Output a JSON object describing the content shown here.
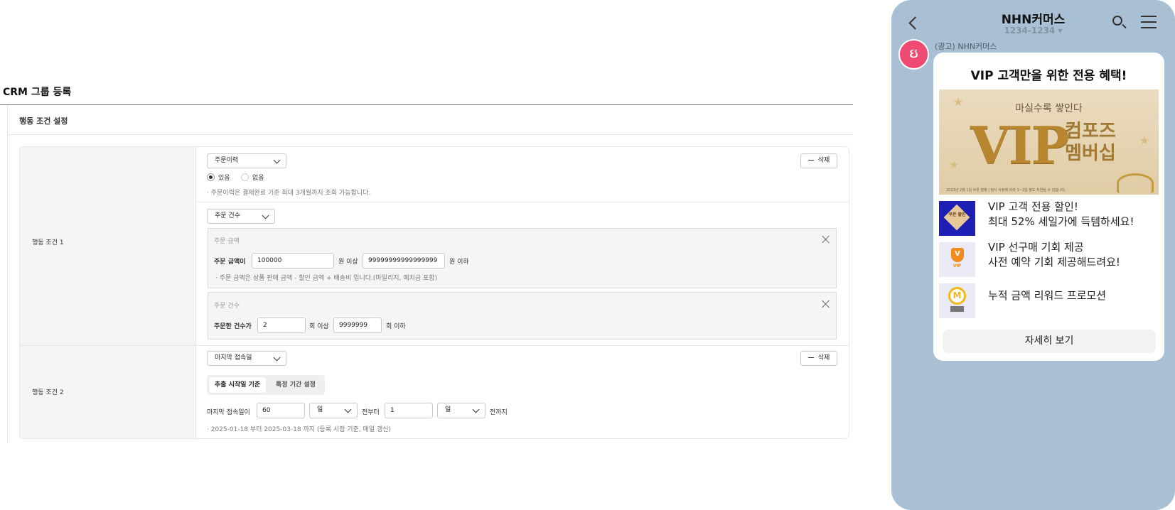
{
  "page": {
    "title": "CRM 그룹 등록",
    "section_title": "행동 조건 설정"
  },
  "condition1": {
    "label": "행동 조건 1",
    "type_select": "주문이력",
    "delete_label": "삭제",
    "radio_yes": "있음",
    "radio_no": "없음",
    "radio_selected": "있음",
    "note": "주문이력은 결제완료 기준 최대 3개월까지 조회 가능합니다.",
    "sub_select": "주문 건수",
    "amount_box": {
      "title": "주문 금액",
      "prefix": "주문 금액이",
      "min_value": "100000",
      "min_suffix": "원 이상",
      "max_value": "99999999999999999",
      "max_suffix": "원 이하",
      "note": "주문 금액은 상품 판매 금액 - 할인 금액 + 배송비 입니다.(마일리지, 예치금 포함)"
    },
    "count_box": {
      "title": "주문 건수",
      "prefix": "주문한 건수가",
      "min_value": "2",
      "min_suffix": "회 이상",
      "max_value": "9999999",
      "max_suffix": "회 이하"
    }
  },
  "condition2": {
    "label": "행동 조건 2",
    "type_select": "마지막 접속일",
    "delete_label": "삭제",
    "tab_active": "추출 시작일 기준",
    "tab_inactive": "특정 기간 설정",
    "prefix": "마지막 접속일이",
    "from_value": "60",
    "from_unit": "일",
    "from_suffix": "전부터",
    "to_value": "1",
    "to_unit": "일",
    "to_suffix": "전까지",
    "note": "2025-01-18 부터 2025-03-18 까지 (등록 시점 기준, 매일 갱신)"
  },
  "phone": {
    "title": "NHN커머스",
    "subtitle": "1234-1234 ▾",
    "sender": "(광고) NHN커머스",
    "avatar_text": "ઇ",
    "card_title": "VIP 고객만을 위한 전용 혜택!",
    "banner": {
      "subtitle": "마실수록 쌓인다",
      "vip": "VIP",
      "side_line1": "컴포즈",
      "side_line2": "멤버십",
      "footer": "2023년 2월 1일 쿠폰 발행 | 당사 사정에 따라 1~2일 정도 지연될 수 있습니다."
    },
    "items": [
      {
        "thumb_label": "쿠폰 할인",
        "line1": "VIP 고객 전용 할인!",
        "line2": "최대 52% 세일가에 득템하세요!"
      },
      {
        "thumb_label": "VIP",
        "line1": "VIP 선구매 기회 제공",
        "line2": "사전 예약 기회 제공해드려요!"
      },
      {
        "thumb_label": "M",
        "line1": "누적 금액 리워드 프로모션",
        "line2": ""
      }
    ],
    "detail_button": "자세히 보기"
  },
  "colors": {
    "phone_bg": "#a9bfd3",
    "avatar": "#ef4b72",
    "banner_gold": "#b8862f",
    "panel_bg": "#f4f5f7"
  }
}
